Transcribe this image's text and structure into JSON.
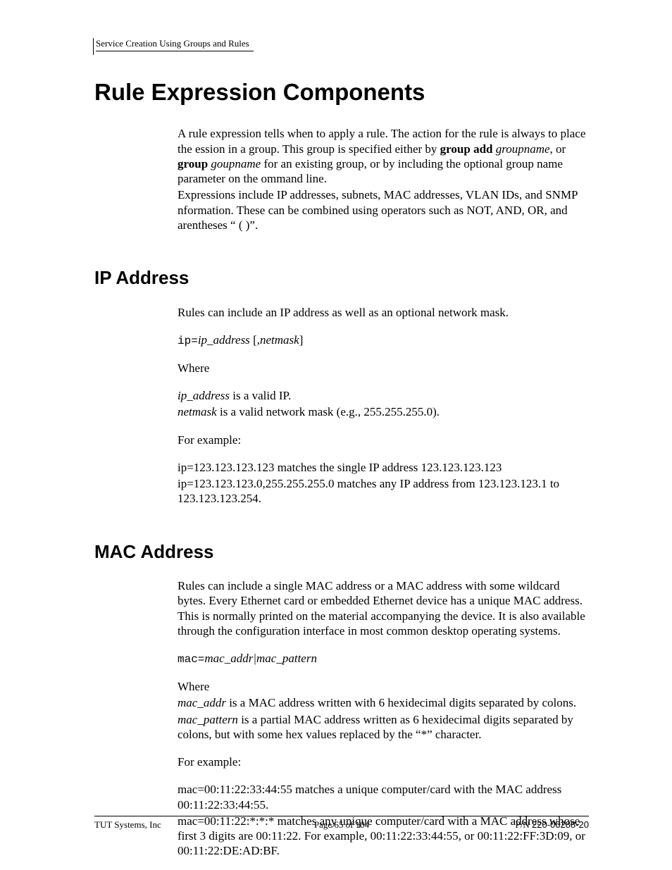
{
  "header": {
    "text": "Service Creation Using Groups and Rules"
  },
  "h1": "Rule Expression Components",
  "intro": {
    "p1a": "A rule expression tells when to apply a rule. The action for the rule is always to place the ession in a group. This group is specified either by ",
    "p1b": "group add",
    "p1c": " ",
    "p1d": "groupname",
    "p1e": ", or ",
    "p1f": "group",
    "p1g": " ",
    "p1h": "goupname",
    "p1i": " for an existing group, or by including the optional group name parameter on the ommand line.",
    "p2": "Expressions include IP addresses, subnets, MAC addresses, VLAN IDs, and SNMP nformation. These can be combined using operators such as NOT, AND, OR, and arentheses “ ( )”."
  },
  "ip": {
    "h2": "IP Address",
    "p1": "Rules can include an IP address as well as an optional network mask.",
    "syn_a": "ip=",
    "syn_b": "ip_address",
    "syn_c": " [,",
    "syn_d": "netmask",
    "syn_e": "]",
    "where": "Where",
    "d1a": "ip_address",
    "d1b": " is a valid IP.",
    "d2a": "netmask",
    "d2b": " is a valid network mask (e.g., 255.255.255.0).",
    "ex_label": "For example:",
    "ex1": "ip=123.123.123.123 matches the single IP address 123.123.123.123",
    "ex2": "ip=123.123.123.0,255.255.255.0 matches any IP address from 123.123.123.1 to 123.123.123.254."
  },
  "mac": {
    "h2": "MAC Address",
    "p1": "Rules can include a single MAC address or a MAC address with some wildcard bytes. Every Ethernet card or embedded Ethernet device has a unique MAC address. This is normally printed on the material accompanying the device. It is also available through the configuration interface in most common desktop operating systems.",
    "syn_a": "mac=",
    "syn_b": "mac_addr|mac_pattern",
    "where": "Where",
    "d1a": "mac_addr",
    "d1b": " is a MAC address written with 6 hexidecimal digits separated by colons.",
    "d2a": "mac_pattern",
    "d2b": " is a partial MAC address written as 6 hexidecimal digits separated by colons, but with some hex values replaced by the “*” character.",
    "ex_label": "For example:",
    "ex1": "mac=00:11:22:33:44:55 matches a unique computer/card with the MAC address 00:11:22:33:44:55.",
    "ex2": "mac=00:11:22:*:*:* matches any unique computer/card with a MAC address whose first 3 digits are 00:11:22. For example, 00:11:22:33:44:55, or 00:11:22:FF:3D:09, or 00:11:22:DE:AD:BF."
  },
  "footer": {
    "left": "TUT Systems, Inc",
    "center": "Page 65 of 104",
    "right_prefix": "P/N ",
    "right_num": "220-06288-20"
  }
}
